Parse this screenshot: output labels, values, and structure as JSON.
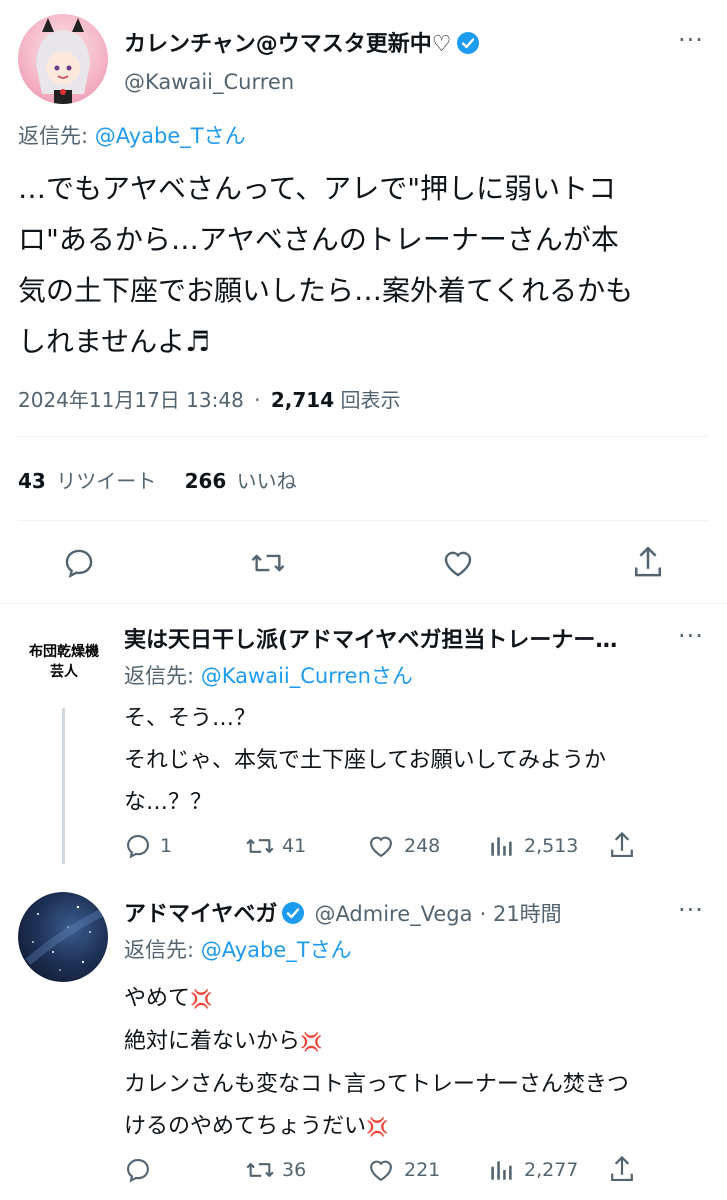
{
  "main_tweet": {
    "display_name": "カレンチャン@ウマスタ更新中♡",
    "handle": "@Kawaii_Curren",
    "reply_to_prefix": "返信先: ",
    "reply_to_user": "@Ayabe_Tさん",
    "text_lines": [
      "…でもアヤベさんって、アレで\"押しに弱いトコ",
      "ロ\"あるから…アヤベさんのトレーナーさんが本",
      "気の土下座でお願いしたら…案外着てくれるかも",
      "しれませんよ♬"
    ],
    "date": "2024年11月17日 13:48",
    "separator": "·",
    "views": "2,714",
    "views_label": "回表示",
    "retweets": "43",
    "retweets_label": "リツイート",
    "likes": "266",
    "likes_label": "いいね"
  },
  "reply1": {
    "display_name": "実は天日干し派(アドマイヤベガ担当トレーナー…",
    "avatar_text_line1": "布団乾燥機",
    "avatar_text_line2": "芸人",
    "reply_to_prefix": "返信先: ",
    "reply_to_user": "@Kawaii_Currenさん",
    "text_lines": [
      "そ、そう…？",
      "それじゃ、本気で土下座してお願いしてみようか",
      "な…？？"
    ],
    "replies": "1",
    "retweets": "41",
    "likes": "248",
    "views": "2,513"
  },
  "reply2": {
    "display_name": "アドマイヤベガ",
    "handle": "@Admire_Vega",
    "time": "· 21時間",
    "reply_to_prefix": "返信先: ",
    "reply_to_user": "@Ayabe_Tさん",
    "text_lines": [
      "やめて",
      "絶対に着ないから",
      "カレンさんも変なコト言ってトレーナーさん焚きつ",
      "けるのやめてちょうだい"
    ],
    "anger_emoji": "💢",
    "retweets": "36",
    "likes": "221",
    "views": "2,277"
  },
  "more_label": "···",
  "colors": {
    "accent": "#1d9bf0",
    "text": "#0f1419",
    "muted": "#536471",
    "divider": "#eff3f4",
    "anger": "#e0245e"
  }
}
